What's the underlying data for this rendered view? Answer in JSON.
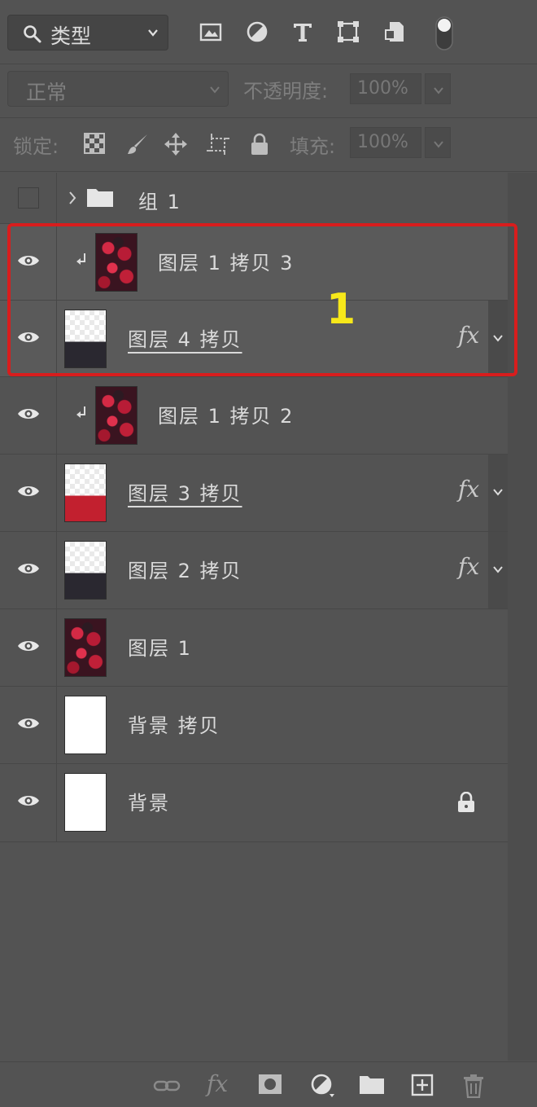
{
  "filter": {
    "kind_label": "类型"
  },
  "blend": {
    "mode": "正常",
    "opacity_label": "不透明度:",
    "opacity_value": "100%"
  },
  "lock": {
    "lock_label": "锁定:",
    "fill_label": "填充:",
    "fill_value": "100%"
  },
  "layers": [
    {
      "name": "组 1",
      "kind": "group",
      "visible": false
    },
    {
      "name": "图层 1 拷贝 3",
      "kind": "image",
      "clipped": true,
      "visible": true
    },
    {
      "name": "图层 4 拷贝",
      "kind": "pixel",
      "has_fx": true,
      "fx_label": "fx",
      "visible": true
    },
    {
      "name": "图层 1 拷贝 2",
      "kind": "image",
      "clipped": true,
      "visible": true
    },
    {
      "name": "图层 3 拷贝",
      "kind": "pixel",
      "has_fx": true,
      "fx_label": "fx",
      "visible": true
    },
    {
      "name": "图层 2 拷贝",
      "kind": "pixel",
      "has_fx": true,
      "fx_label": "fx",
      "visible": true
    },
    {
      "name": "图层 1",
      "kind": "image",
      "visible": true
    },
    {
      "name": "背景 拷贝",
      "kind": "white",
      "visible": true
    },
    {
      "name": "背景",
      "kind": "white",
      "locked": true,
      "visible": true
    }
  ],
  "annotation": {
    "number": "1",
    "color": "#d81d1d",
    "number_color": "#f7e81a"
  },
  "colors": {
    "panel_bg": "#535353",
    "thumb_red": "#c2202f",
    "thumb_dark": "#2a2830"
  }
}
